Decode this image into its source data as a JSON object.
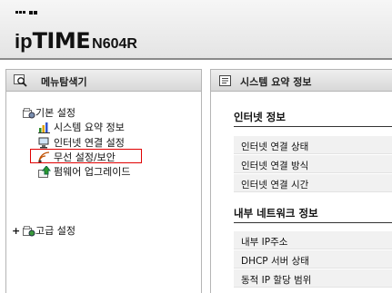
{
  "header": {
    "brand_ip": "ip",
    "brand_time": "TIME",
    "model": "N604R"
  },
  "left_panel": {
    "title": "메뉴탐색기",
    "tree": {
      "basic_settings": "기본 설정",
      "items": [
        {
          "label": "시스템 요약 정보",
          "icon": "chart-icon"
        },
        {
          "label": "인터넷 연결 설정",
          "icon": "network-icon"
        },
        {
          "label": "무선 설정/보안",
          "icon": "wireless-icon",
          "selected": true
        },
        {
          "label": "펌웨어 업그레이드",
          "icon": "upgrade-icon"
        }
      ],
      "advanced_settings": "고급 설정"
    }
  },
  "right_panel": {
    "title": "시스템 요약 정보",
    "internet_section": {
      "title": "인터넷 정보",
      "rows": [
        "인터넷 연결 상태",
        "인터넷 연결 방식",
        "인터넷 연결 시간"
      ]
    },
    "lan_section": {
      "title": "내부 네트워크 정보",
      "rows": [
        "내부 IP주소",
        "DHCP 서버 상태",
        "동적 IP 할당 범위"
      ]
    }
  },
  "colors": {
    "highlight": "#e00000",
    "row_background": "#f1f1f1"
  }
}
